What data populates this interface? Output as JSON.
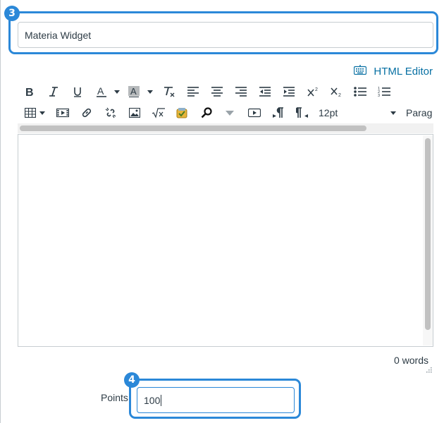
{
  "steps": {
    "title_step": "3",
    "points_step": "4"
  },
  "title_field": {
    "value": "Materia Widget"
  },
  "html_editor": {
    "label": "HTML Editor",
    "icon": "keyboard-icon"
  },
  "toolbar": {
    "row1": [
      "bold-icon",
      "italic-icon",
      "underline-icon",
      "text-color-icon",
      "background-color-icon",
      "clear-formatting-icon",
      "align-left-icon",
      "align-center-icon",
      "align-right-icon",
      "outdent-icon",
      "indent-icon",
      "superscript-icon",
      "subscript-icon",
      "bullet-list-icon",
      "numbered-list-icon"
    ],
    "row2": [
      "table-icon",
      "media-icon",
      "link-icon",
      "unlink-icon",
      "image-icon",
      "math-icon",
      "apps-icon",
      "search-icon",
      "record-icon",
      "ltr-icon",
      "rtl-icon"
    ],
    "font_size": "12pt",
    "format_select": "Parag"
  },
  "editor": {
    "word_count": "0 words"
  },
  "points": {
    "label": "Points",
    "value": "100"
  },
  "colors": {
    "accent": "#2b88d8",
    "link": "#0770a3",
    "text": "#2d3b45",
    "border": "#c7cdd1"
  }
}
